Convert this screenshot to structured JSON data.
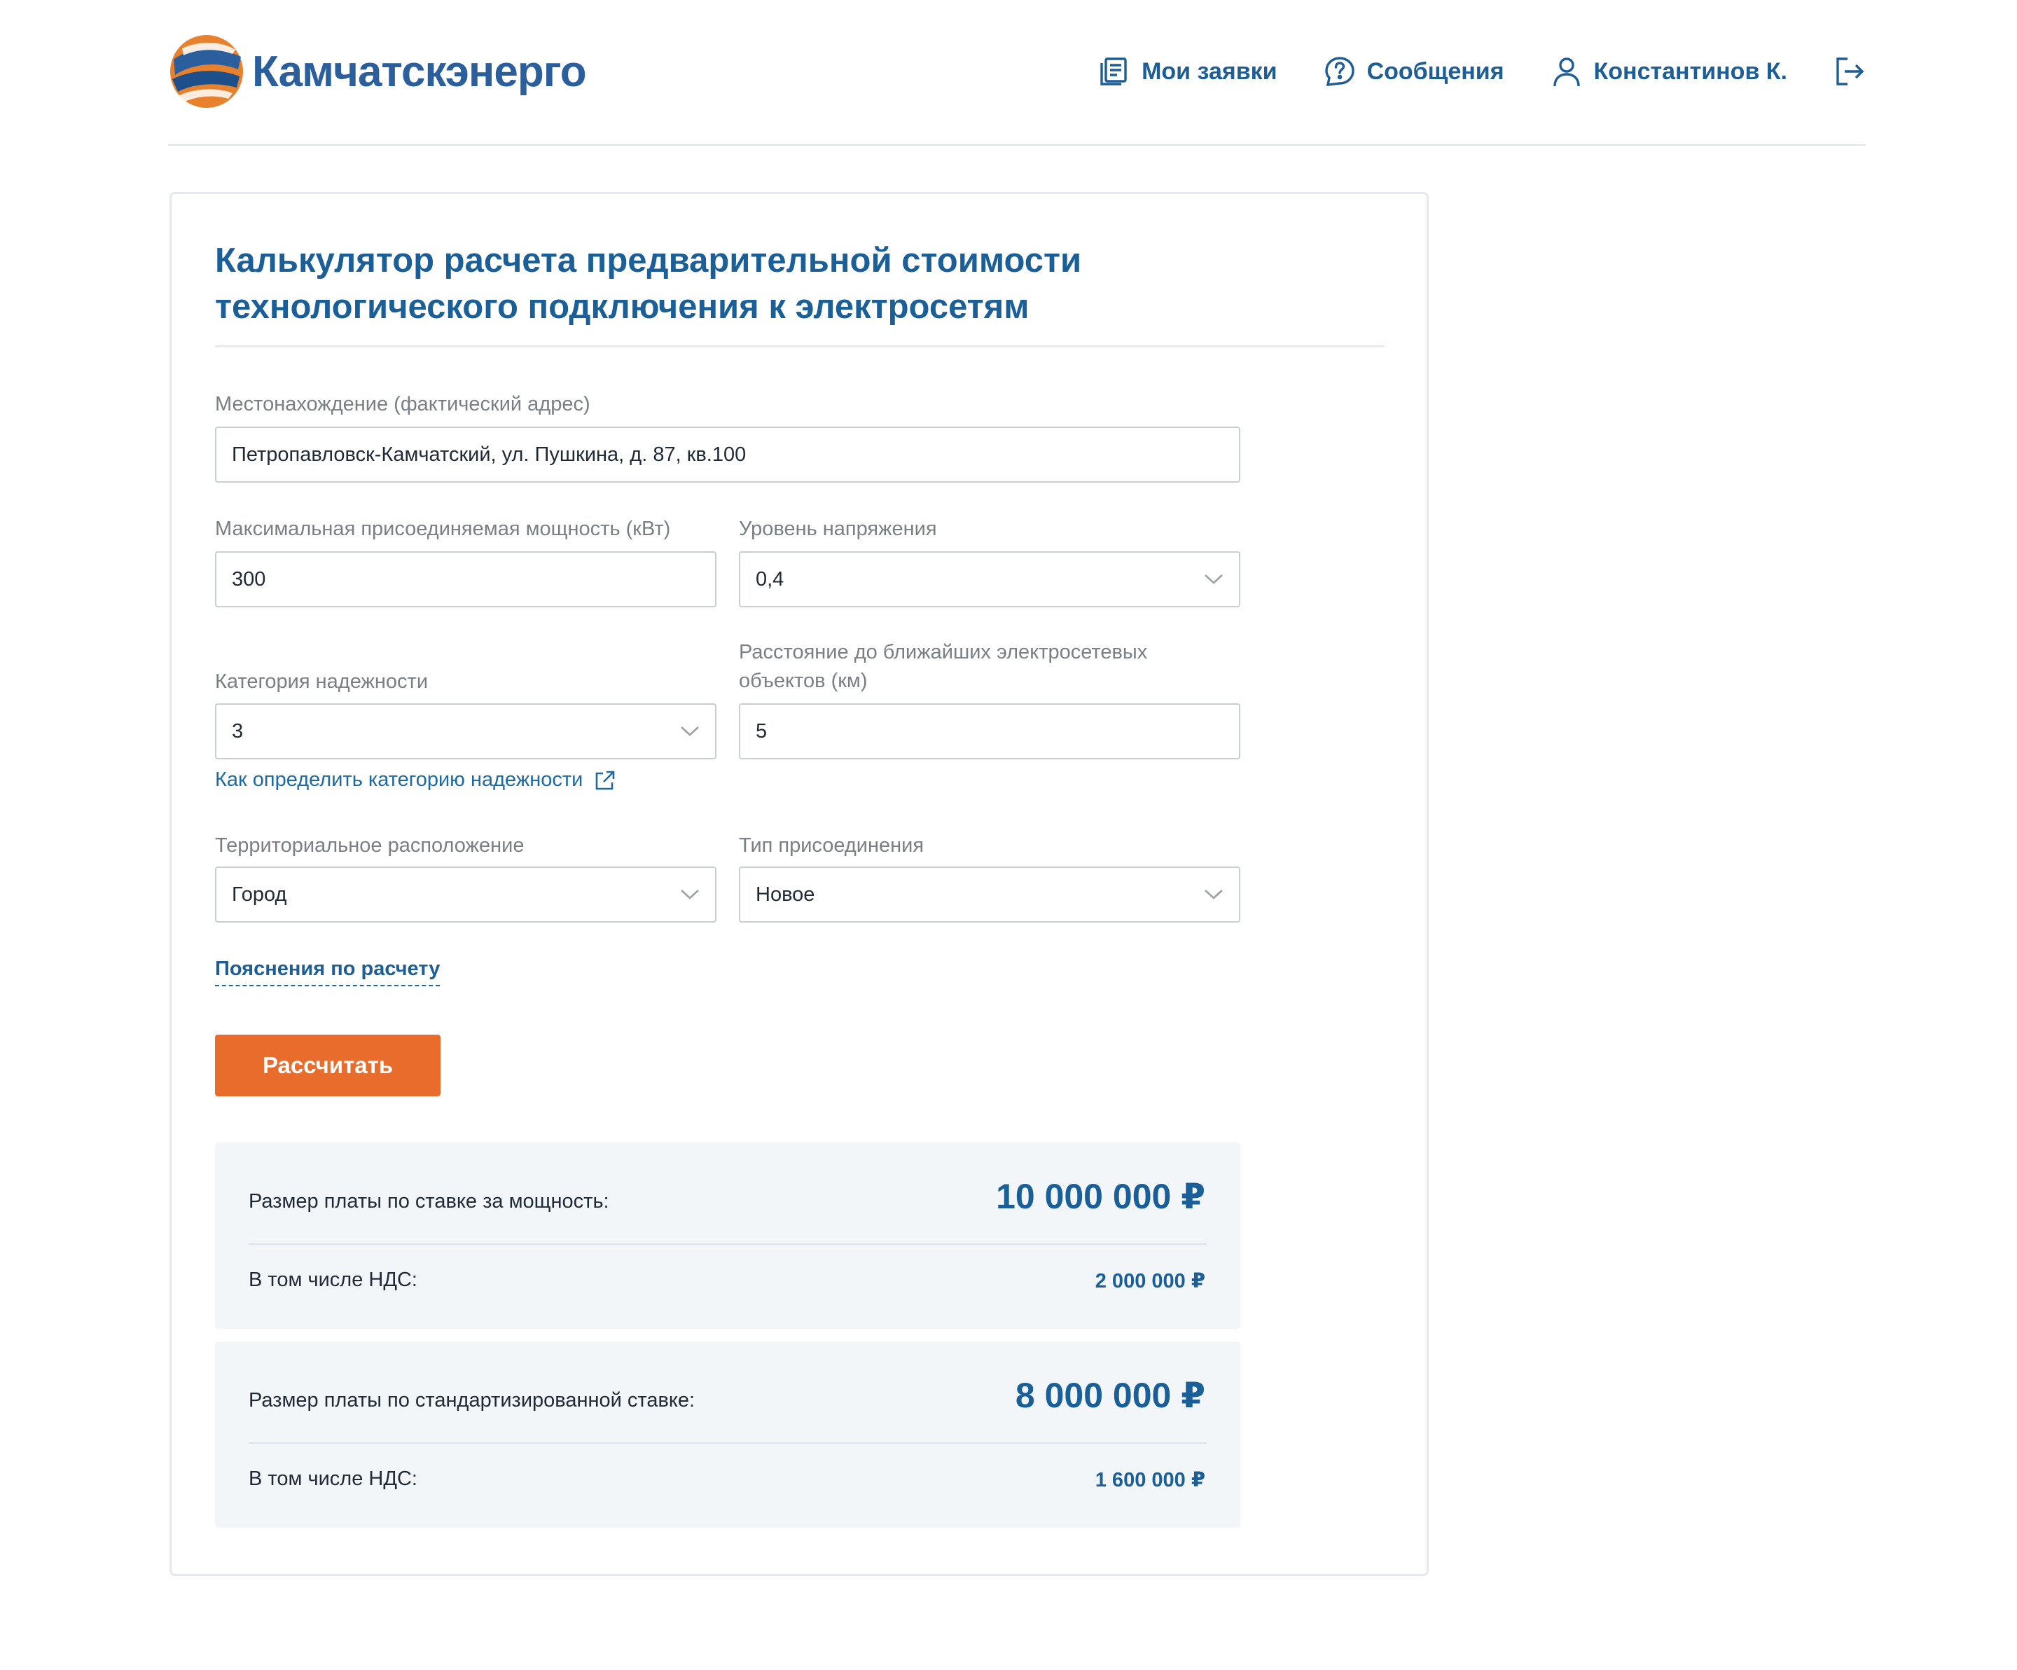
{
  "brand": {
    "name": "Камчатскэнерго",
    "colors": {
      "orange": "#e87a2a",
      "blue": "#2a5e9c"
    }
  },
  "nav": {
    "my_requests": {
      "label": "Мои заявки",
      "icon": "document-list-icon"
    },
    "messages": {
      "label": "Сообщения",
      "icon": "question-bubble-icon"
    },
    "user": {
      "label": "Константинов К.",
      "icon": "user-icon"
    },
    "logout_icon": "logout-icon"
  },
  "calculator": {
    "title_line1": "Калькулятор расчета предварительной стоимости",
    "title_line2": "технологического подключения к электросетям",
    "address": {
      "label": "Местонахождение (фактический адрес)",
      "value": "Петропавловск-Камчатский, ул. Пушкина, д. 87, кв.100"
    },
    "power": {
      "label": "Максимальная присоединяемая мощность (кВт)",
      "value": "300"
    },
    "voltage": {
      "label": "Уровень напряжения",
      "value": "0,4"
    },
    "reliability": {
      "label": "Категория надежности",
      "value": "3"
    },
    "distance": {
      "label_line1": "Расстояние до ближайших электросетевых",
      "label_line2": "объектов (км)",
      "value": "5"
    },
    "reliability_link": "Как определить категорию надежности",
    "territory": {
      "label": "Территориальное расположение",
      "value": "Город"
    },
    "connection_type": {
      "label": "Тип присоединения",
      "value": "Новое"
    },
    "explanations_link": "Пояснения по расчету",
    "calculate_button": "Рассчитать"
  },
  "results": {
    "power_rate": {
      "label": "Размер платы по ставке за мощность:",
      "amount": "10 000 000 ₽",
      "vat_label": "В том числе НДС:",
      "vat_amount": "2 000 000 ₽"
    },
    "standard_rate": {
      "label": "Размер платы по стандартизированной ставке:",
      "amount": "8 000 000 ₽",
      "vat_label": "В том числе НДС:",
      "vat_amount": "1 600 000 ₽"
    }
  }
}
